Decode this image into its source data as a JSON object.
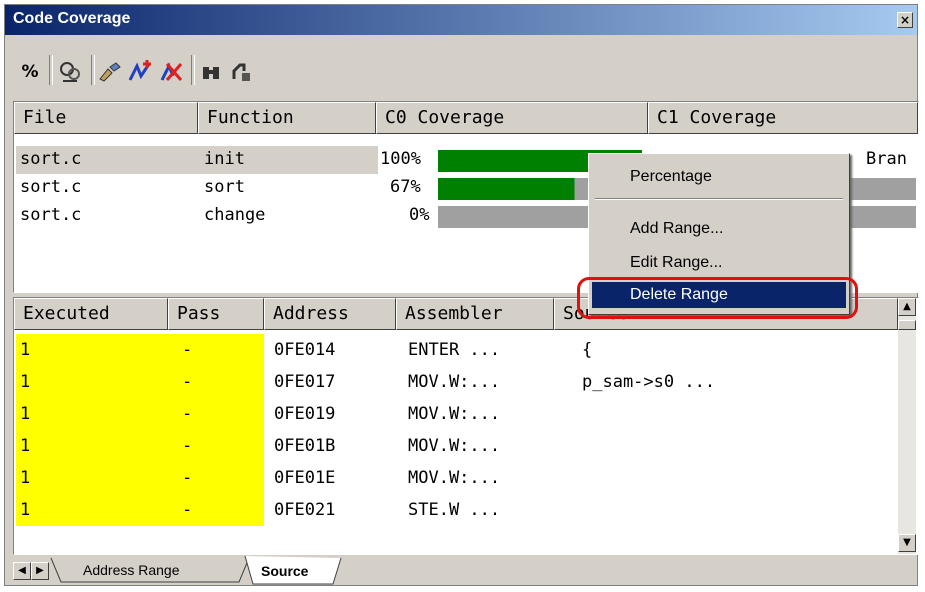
{
  "window": {
    "title": "Code Coverage",
    "close_glyph": "×"
  },
  "toolbar": {
    "percent_label": "%",
    "icons": [
      "percent-icon",
      "filter-icon",
      "add-range-brush-icon",
      "add-range-icon",
      "delete-range-icon",
      "find-icon",
      "refresh-icon"
    ]
  },
  "coverage_table": {
    "headers": [
      "File",
      "Function",
      "C0 Coverage",
      "C1 Coverage"
    ],
    "rows": [
      {
        "file": "sort.c",
        "function": "init",
        "c0": "100%",
        "c0_fraction": 1.0,
        "c1_text": "Bran"
      },
      {
        "file": "sort.c",
        "function": "sort",
        "c0": "67%",
        "c0_fraction": 0.67,
        "c1_text": ""
      },
      {
        "file": "sort.c",
        "function": "change",
        "c0": "0%",
        "c0_fraction": 0.0,
        "c1_text": ""
      }
    ]
  },
  "context_menu": {
    "items": [
      "Percentage",
      "Add Range...",
      "Edit Range...",
      "Delete Range"
    ],
    "selected": "Delete Range"
  },
  "source_table": {
    "headers": [
      "Executed",
      "Pass",
      "Address",
      "Assembler",
      "Source"
    ],
    "rows": [
      {
        "executed": "1",
        "pass": "-",
        "address": "0FE014",
        "assembler": "ENTER ...",
        "source": "{"
      },
      {
        "executed": "1",
        "pass": "-",
        "address": "0FE017",
        "assembler": "MOV.W:...",
        "source": "p_sam->s0 ..."
      },
      {
        "executed": "1",
        "pass": "-",
        "address": "0FE019",
        "assembler": "MOV.W:...",
        "source": ""
      },
      {
        "executed": "1",
        "pass": "-",
        "address": "0FE01B",
        "assembler": "MOV.W:...",
        "source": ""
      },
      {
        "executed": "1",
        "pass": "-",
        "address": "0FE01E",
        "assembler": "MOV.W:...",
        "source": ""
      },
      {
        "executed": "1",
        "pass": "-",
        "address": "0FE021",
        "assembler": "STE.W ...",
        "source": ""
      }
    ]
  },
  "tabs": {
    "items": [
      "Address Range",
      "Source"
    ],
    "active": "Source"
  },
  "colors": {
    "executed_highlight": "#ffff00",
    "covered": "#008000",
    "uncovered": "#a0a0a0",
    "menu_selected": "#0a246a",
    "ring": "#e01010"
  }
}
